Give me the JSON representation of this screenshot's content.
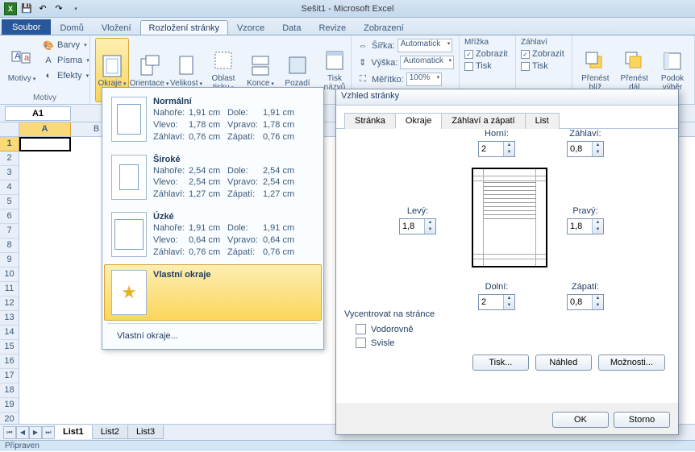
{
  "title": "Sešit1 - Microsoft Excel",
  "tabs": {
    "file": "Soubor",
    "items": [
      "Domů",
      "Vložení",
      "Rozložení stránky",
      "Vzorce",
      "Data",
      "Revize",
      "Zobrazení"
    ],
    "active": 2
  },
  "ribbon": {
    "themes": {
      "motivy": "Motivy",
      "barvy": "Barvy",
      "pisma": "Písma",
      "efekty": "Efekty",
      "group": "Motivy"
    },
    "page_setup": {
      "okraje": "Okraje",
      "orientace": "Orientace",
      "velikost": "Velikost",
      "oblast": "Oblast\ntisku",
      "konce": "Konce",
      "pozadi": "Pozadí",
      "tisk": "Tisk\nnázvů"
    },
    "scale": {
      "sirka": "Šířka:",
      "vyska": "Výška:",
      "meritko": "Měřítko:",
      "auto": "Automatick",
      "pct": "100%"
    },
    "gridlines": {
      "title": "Mřížka",
      "zobrazit": "Zobrazit",
      "tisk": "Tisk"
    },
    "headings": {
      "title": "Záhlaví",
      "zobrazit": "Zobrazit",
      "tisk": "Tisk"
    },
    "arrange": {
      "prenest1": "Přenést\nblíž",
      "prenest2": "Přenést\ndál",
      "podok": "Podok\nvýběr"
    }
  },
  "namebox": "A1",
  "columns": [
    "A",
    "B"
  ],
  "rows": 20,
  "sheets": {
    "items": [
      "List1",
      "List2",
      "List3"
    ],
    "active": 0
  },
  "status": "Připraven",
  "margins_menu": {
    "options": [
      {
        "name": "Normální",
        "rows": [
          [
            "Nahoře:",
            "1,91 cm",
            "Dole:",
            "1,91 cm"
          ],
          [
            "Vlevo:",
            "1,78 cm",
            "Vpravo:",
            "1,78 cm"
          ],
          [
            "Záhlaví:",
            "0,76 cm",
            "Zápatí:",
            "0,76 cm"
          ]
        ],
        "insets": [
          8,
          6,
          8,
          6
        ]
      },
      {
        "name": "Široké",
        "rows": [
          [
            "Nahoře:",
            "2,54 cm",
            "Dole:",
            "2,54 cm"
          ],
          [
            "Vlevo:",
            "2,54 cm",
            "Vpravo:",
            "2,54 cm"
          ],
          [
            "Záhlaví:",
            "1,27 cm",
            "Zápatí:",
            "1,27 cm"
          ]
        ],
        "insets": [
          11,
          9,
          11,
          9
        ]
      },
      {
        "name": "Úzké",
        "rows": [
          [
            "Nahoře:",
            "1,91 cm",
            "Dole:",
            "1,91 cm"
          ],
          [
            "Vlevo:",
            "0,64 cm",
            "Vpravo:",
            "0,64 cm"
          ],
          [
            "Záhlaví:",
            "0,76 cm",
            "Zápatí:",
            "0,76 cm"
          ]
        ],
        "insets": [
          8,
          3,
          8,
          3
        ]
      }
    ],
    "custom_title": "Vlastní okraje",
    "custom_cmd": "Vlastní okraje..."
  },
  "dialog": {
    "title": "Vzhled stránky",
    "tabs": [
      "Stránka",
      "Okraje",
      "Záhlaví a zápatí",
      "List"
    ],
    "active_tab": 1,
    "fields": {
      "horni": {
        "label": "Horní:",
        "value": "2"
      },
      "zahlavi": {
        "label": "Záhlaví:",
        "value": "0,8"
      },
      "levy": {
        "label": "Levý:",
        "value": "1,8"
      },
      "pravy": {
        "label": "Pravý:",
        "value": "1,8"
      },
      "dolni": {
        "label": "Dolní:",
        "value": "2"
      },
      "zapati": {
        "label": "Zápatí:",
        "value": "0,8"
      }
    },
    "center": {
      "title": "Vycentrovat na stránce",
      "h": "Vodorovně",
      "v": "Svisle"
    },
    "buttons": {
      "tisk": "Tisk...",
      "nahled": "Náhled",
      "moznosti": "Možnosti...",
      "ok": "OK",
      "storno": "Storno"
    }
  }
}
